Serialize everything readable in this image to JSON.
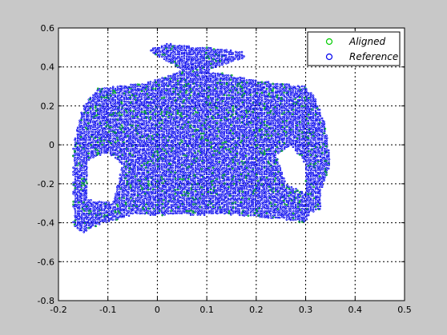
{
  "chart_data": {
    "type": "scatter",
    "title": "",
    "xlabel": "",
    "ylabel": "",
    "xlim": [
      -0.2,
      0.5
    ],
    "ylim": [
      -0.8,
      0.6
    ],
    "x_ticks": [
      "-0.2",
      "-0.1",
      "0",
      "0.1",
      "0.2",
      "0.3",
      "0.4",
      "0.5"
    ],
    "y_ticks": [
      "0.6",
      "0.4",
      "0.2",
      "0",
      "-0.2",
      "-0.4",
      "-0.6",
      "-0.8"
    ],
    "x_tick_values": [
      -0.2,
      -0.1,
      0,
      0.1,
      0.2,
      0.3,
      0.4,
      0.5
    ],
    "y_tick_values": [
      0.6,
      0.4,
      0.2,
      0,
      -0.2,
      -0.4,
      -0.6,
      -0.8
    ],
    "grid": true,
    "grid_style": "dotted",
    "legend_position": "top-right",
    "series": [
      {
        "name": "Aligned",
        "marker": "circle-open",
        "color": "#00cc00",
        "shape_description": "shirt-shaped point cloud",
        "outline": [
          [
            -0.02,
            0.49
          ],
          [
            0.02,
            0.52
          ],
          [
            0.1,
            0.5
          ],
          [
            0.17,
            0.48
          ],
          [
            0.18,
            0.45
          ],
          [
            0.13,
            0.41
          ],
          [
            0.1,
            0.38
          ],
          [
            0.2,
            0.33
          ],
          [
            0.3,
            0.3
          ],
          [
            0.32,
            0.24
          ],
          [
            0.34,
            0.1
          ],
          [
            0.35,
            -0.1
          ],
          [
            0.33,
            -0.25
          ],
          [
            0.33,
            -0.33
          ],
          [
            0.31,
            -0.35
          ],
          [
            0.3,
            -0.4
          ],
          [
            0.25,
            -0.38
          ],
          [
            0.15,
            -0.36
          ],
          [
            0.05,
            -0.36
          ],
          [
            -0.05,
            -0.36
          ],
          [
            -0.12,
            -0.41
          ],
          [
            -0.15,
            -0.45
          ],
          [
            -0.17,
            -0.42
          ],
          [
            -0.17,
            -0.3
          ],
          [
            -0.17,
            0.0
          ],
          [
            -0.15,
            0.2
          ],
          [
            -0.12,
            0.29
          ],
          [
            -0.02,
            0.32
          ],
          [
            0.05,
            0.38
          ]
        ]
      },
      {
        "name": "Reference",
        "marker": "circle-open",
        "color": "#0000ee",
        "shape_description": "shirt-shaped point cloud",
        "outline": [
          [
            -0.02,
            0.49
          ],
          [
            0.02,
            0.52
          ],
          [
            0.1,
            0.5
          ],
          [
            0.17,
            0.48
          ],
          [
            0.18,
            0.45
          ],
          [
            0.13,
            0.41
          ],
          [
            0.1,
            0.38
          ],
          [
            0.2,
            0.33
          ],
          [
            0.3,
            0.3
          ],
          [
            0.32,
            0.24
          ],
          [
            0.34,
            0.1
          ],
          [
            0.35,
            -0.1
          ],
          [
            0.33,
            -0.25
          ],
          [
            0.33,
            -0.33
          ],
          [
            0.31,
            -0.35
          ],
          [
            0.3,
            -0.4
          ],
          [
            0.25,
            -0.38
          ],
          [
            0.15,
            -0.36
          ],
          [
            0.05,
            -0.36
          ],
          [
            -0.05,
            -0.36
          ],
          [
            -0.12,
            -0.41
          ],
          [
            -0.15,
            -0.45
          ],
          [
            -0.17,
            -0.42
          ],
          [
            -0.17,
            -0.3
          ],
          [
            -0.17,
            0.0
          ],
          [
            -0.15,
            0.2
          ],
          [
            -0.12,
            0.29
          ],
          [
            -0.02,
            0.32
          ],
          [
            0.05,
            0.38
          ]
        ],
        "holes": [
          [
            [
              -0.14,
              -0.08
            ],
            [
              -0.1,
              -0.04
            ],
            [
              -0.07,
              -0.1
            ],
            [
              -0.09,
              -0.3
            ],
            [
              -0.14,
              -0.28
            ]
          ],
          [
            [
              0.24,
              -0.05
            ],
            [
              0.27,
              0.0
            ],
            [
              0.3,
              -0.1
            ],
            [
              0.3,
              -0.25
            ],
            [
              0.26,
              -0.2
            ]
          ]
        ]
      }
    ],
    "colors": {
      "figure_background": "#c8c8c8",
      "axes_background": "#ffffff",
      "grid": "#000000"
    }
  },
  "legend": {
    "entries": [
      "Aligned",
      "Reference"
    ]
  }
}
